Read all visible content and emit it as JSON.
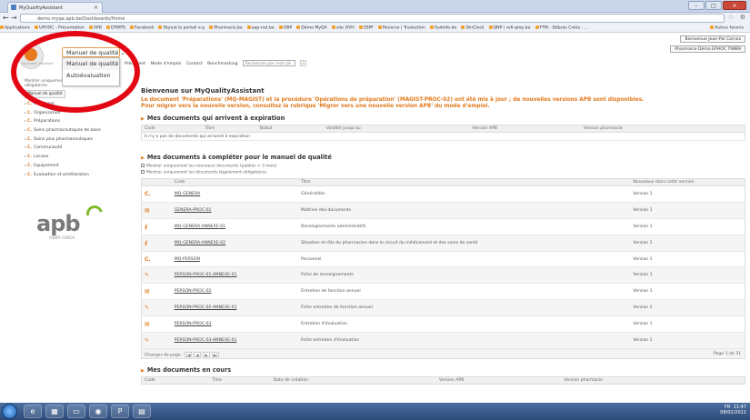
{
  "browser": {
    "tab_title": "MyQualityAssistant",
    "url": "demo.myqa.apb.be/Dashboards/Home",
    "bookmarks": [
      "Applications",
      "UPHOC - Présentation",
      "APB",
      "EPWPS",
      "Facebook",
      "Skyest le portail e-p",
      "Pharmacie.be",
      "aap-net.be",
      "OBP",
      "Démo MyQA",
      "site OVH",
      "SSPF",
      "Reverso | Traduction",
      "Sudinfo.be",
      "DinClock",
      "QNP | refi-qmp.be",
      "FTM - Débuts Créés - ...",
      "Autres favoris"
    ]
  },
  "header": {
    "user_select": "Bienvenue Jean-Pol Cornez",
    "pharmacy_select": "Pharmacie Démo EPHOC T9889"
  },
  "logo": {
    "brand_text": "MyQuality Assistant"
  },
  "menu": {
    "trigger_label": "Manuel de qualité ⌄",
    "items": [
      "Manuel de qualité",
      "Autoévaluation"
    ]
  },
  "topnav": {
    "items": [
      "Précédent",
      "Mode d'emploi",
      "Contact",
      "Benchmarking"
    ],
    "search_placeholder": "Recherche par mot-clé",
    "search_icon": "search-icon"
  },
  "sidebar": {
    "note": "Montrer uniquement les documents légalement obligatoires",
    "button": "Manuel de qualité",
    "items": [
      {
        "code": "C.",
        "label": "Personnel"
      },
      {
        "code": "C.",
        "label": "Organisation"
      },
      {
        "code": "C.",
        "label": "Préparations"
      },
      {
        "code": "C.",
        "label": "Soins pharmaceutiques de base"
      },
      {
        "code": "C.",
        "label": "Soins plus pharmaceutiques"
      },
      {
        "code": "C.",
        "label": "Communauté"
      },
      {
        "code": "C.",
        "label": "Locaux"
      },
      {
        "code": "C.",
        "label": "Equipement"
      },
      {
        "code": "C.",
        "label": "Evaluation et amélioration"
      }
    ],
    "partner_logo": "apb",
    "partner_sub": "OBBP-OWDA"
  },
  "main": {
    "welcome": "Bienvenue sur MyQualityAssistant",
    "alert_line1": "Le document 'Préparations' (MQ-MAGIST) et la procédure 'Opérations de préparation' (MAGIST-PROC-02) ont été mis à jour ; de nouvelles versions APB sont disponibles.",
    "alert_line2": "Pour migrer vers la nouvelle version, consultez la rubrique 'Migrer vers une nouvelle version APB' du mode d'emploi.",
    "expiring": {
      "title": "Mes documents qui arrivent à expiration",
      "columns": [
        "Code",
        "Titre",
        "Statut",
        "Validité jusqu'au",
        "Version APB",
        "Version pharmacie"
      ],
      "empty": "Il n'y a pas de documents qui arrivent à expiration"
    },
    "to_complete": {
      "title": "Mes documents à compléter pour le manuel de qualité",
      "filter1": "Montrer uniquement les nouveaux documents (publiés < 3 mois)",
      "filter2": "Montrer uniquement les documents légalement obligatoires",
      "columns": [
        "Code",
        "Titre",
        "Nouveaux dans cette version"
      ],
      "rows": [
        {
          "icon": "C.",
          "code": "MQ-GENERA",
          "title": "Généralités",
          "version": "Version 1"
        },
        {
          "icon": "▤",
          "code": "GENERA-PROC-01",
          "title": "Maîtrise des documents",
          "version": "Version 1"
        },
        {
          "icon": "∮",
          "code": "MQ-GENERA-ANNEXE-01",
          "title": "Renseignements administratifs",
          "version": "Version 1"
        },
        {
          "icon": "∮",
          "code": "MQ-GENERA-ANNEXE-02",
          "title": "Situation et rôle du pharmacien dans le circuit du médicament et des soins de santé",
          "version": "Version 1"
        },
        {
          "icon": "C.",
          "code": "MQ-PERSON",
          "title": "Personnel",
          "version": "Version 1"
        },
        {
          "icon": "✎",
          "code": "PERSON-PROC-01-ANNEXE-01",
          "title": "Fiche de renseignements",
          "version": "Version 1"
        },
        {
          "icon": "▤",
          "code": "PERSON-PROC-02",
          "title": "Entretien de fonction annuel",
          "version": "Version 1"
        },
        {
          "icon": "✎",
          "code": "PERSON-PROC-02-ANNEXE-01",
          "title": "Fiche entretien de fonction annuel",
          "version": "Version 1"
        },
        {
          "icon": "▤",
          "code": "PERSON-PROC-03",
          "title": "Entretien d'évaluation",
          "version": "Version 1"
        },
        {
          "icon": "✎",
          "code": "PERSON-PROC-03-ANNEXE-01",
          "title": "Fiche entretien d'évaluation",
          "version": "Version 1"
        }
      ],
      "pager_label": "Changer de page :",
      "pager_buttons": [
        "|◀",
        "◀",
        "▶",
        "▶|"
      ],
      "page_info": "Page 1 de 31"
    },
    "in_progress": {
      "title": "Mes documents en cours",
      "columns": [
        "Code",
        "Titre",
        "Date de création",
        "Version APB",
        "Version pharmacie"
      ]
    }
  },
  "taskbar": {
    "time": "11:47",
    "date": "08/02/2011",
    "lang": "FR"
  },
  "colors": {
    "accent": "#e07a1e",
    "highlight_circle": "#e30613",
    "apb_green": "#7fba2f"
  }
}
